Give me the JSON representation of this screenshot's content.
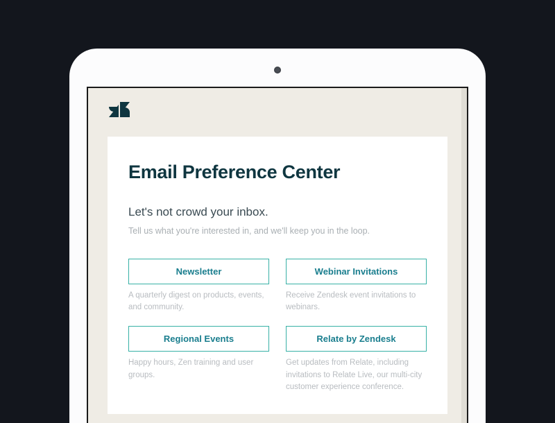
{
  "page": {
    "title": "Email Preference Center",
    "subtitle": "Let's not crowd your inbox.",
    "description": "Tell us what you're interested in, and we'll keep you in the loop."
  },
  "options": [
    {
      "label": "Newsletter",
      "description": "A quarterly digest on products, events, and community."
    },
    {
      "label": "Webinar Invitations",
      "description": "Receive Zendesk event invitations to webinars."
    },
    {
      "label": "Regional Events",
      "description": "Happy hours, Zen training and user groups."
    },
    {
      "label": "Relate by Zendesk",
      "description": "Get updates from Relate, including invitations to Relate Live, our multi-city customer experience conference."
    }
  ],
  "brand": {
    "logo_color": "#0f3640",
    "accent_color": "#37b1a6"
  }
}
